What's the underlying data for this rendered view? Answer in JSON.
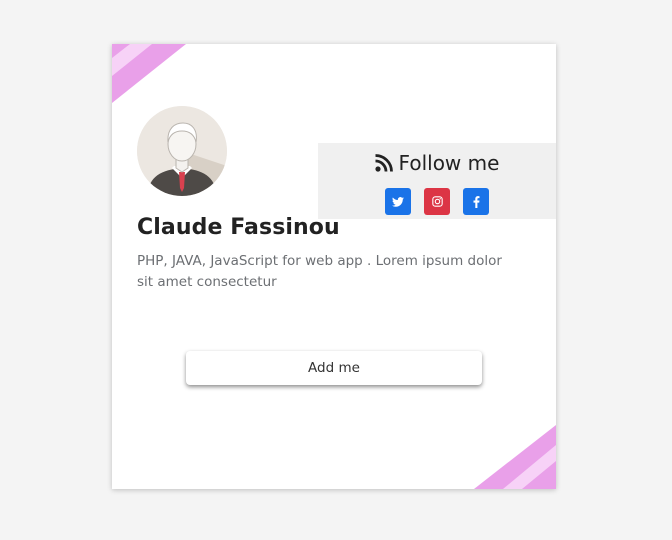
{
  "profile": {
    "name": "Claude Fassinou",
    "description": "PHP, JAVA, JavaScript for web app . Lorem ipsum dolor sit amet consectetur"
  },
  "follow": {
    "title": "Follow me",
    "socials": [
      {
        "name": "twitter",
        "icon": "twitter-icon",
        "color": "#1a73e8"
      },
      {
        "name": "instagram",
        "icon": "instagram-icon",
        "color": "#dc3545"
      },
      {
        "name": "facebook",
        "icon": "facebook-icon",
        "color": "#1a73e8"
      }
    ]
  },
  "actions": {
    "add_label": "Add me"
  },
  "colors": {
    "accent_stripe": "#e9a0e9",
    "accent_stripe_light": "#f7d2f7"
  }
}
